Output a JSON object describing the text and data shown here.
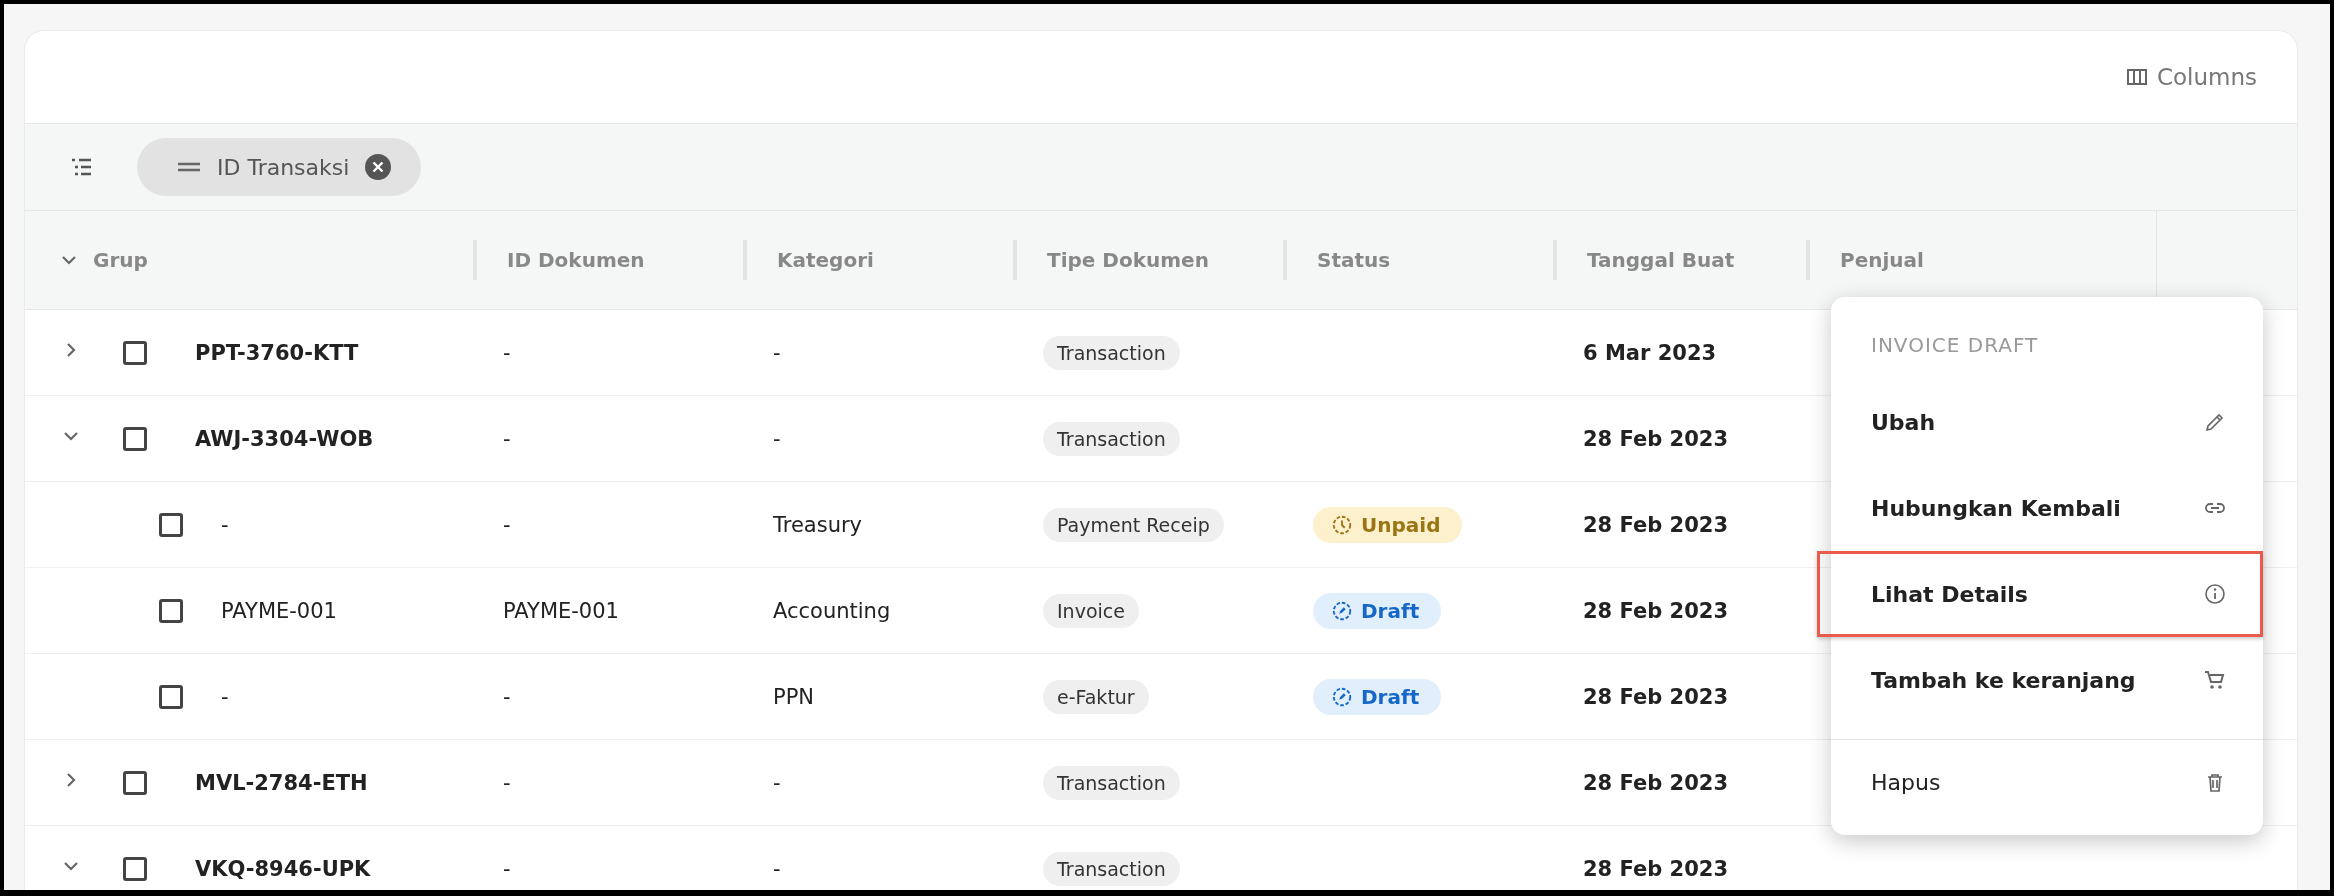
{
  "toolbar": {
    "columns_button": "Columns"
  },
  "filter_bar": {
    "chips": [
      {
        "label": "ID Transaksi"
      }
    ]
  },
  "table": {
    "group_header": {
      "label": "Grup",
      "expanded": true
    },
    "columns": [
      "ID Dokumen",
      "Kategori",
      "Tipe Dokumen",
      "Status",
      "Tanggal Buat",
      "Penjual"
    ],
    "rows": [
      {
        "expanded": false,
        "checked": false,
        "group": "PPT-3760-KTT",
        "id_dokumen": "-",
        "kategori": "-",
        "tipe_dokumen": "Transaction",
        "tanggal": "6 Mar 2023"
      },
      {
        "expanded": true,
        "checked": false,
        "group": "AWJ-3304-WOB",
        "id_dokumen": "-",
        "kategori": "-",
        "tipe_dokumen": "Transaction",
        "tanggal": "28 Feb 2023",
        "children": [
          {
            "checked": false,
            "group": "-",
            "id_dokumen": "-",
            "kategori": "Treasury",
            "tipe_dokumen": "Payment Receip",
            "status": {
              "label": "Unpaid",
              "kind": "unpaid"
            },
            "tanggal": "28 Feb 2023"
          },
          {
            "checked": false,
            "group": "PAYME-001",
            "id_dokumen": "PAYME-001",
            "kategori": "Accounting",
            "tipe_dokumen": "Invoice",
            "status": {
              "label": "Draft",
              "kind": "draft"
            },
            "tanggal": "28 Feb 2023"
          },
          {
            "checked": false,
            "group": "-",
            "id_dokumen": "-",
            "kategori": "PPN",
            "tipe_dokumen": "e-Faktur",
            "status": {
              "label": "Draft",
              "kind": "draft"
            },
            "tanggal": "28 Feb 2023"
          }
        ]
      },
      {
        "expanded": false,
        "checked": false,
        "group": "MVL-2784-ETH",
        "id_dokumen": "-",
        "kategori": "-",
        "tipe_dokumen": "Transaction",
        "tanggal": "28 Feb 2023"
      },
      {
        "expanded": true,
        "checked": false,
        "group": "VKQ-8946-UPK",
        "id_dokumen": "-",
        "kategori": "-",
        "tipe_dokumen": "Transaction",
        "tanggal": "28 Feb 2023"
      }
    ]
  },
  "context_menu": {
    "title": "INVOICE DRAFT",
    "items": [
      {
        "label": "Ubah",
        "kind": "action",
        "highlighted": false,
        "divider_before": false
      },
      {
        "label": "Hubungkan Kembali",
        "kind": "action",
        "highlighted": false,
        "divider_before": false
      },
      {
        "label": "Lihat Details",
        "kind": "action",
        "highlighted": true,
        "divider_before": false
      },
      {
        "label": "Tambah ke keranjang",
        "kind": "action",
        "highlighted": false,
        "divider_before": false
      },
      {
        "label": "Hapus",
        "kind": "plain",
        "highlighted": false,
        "divider_before": true
      }
    ]
  }
}
